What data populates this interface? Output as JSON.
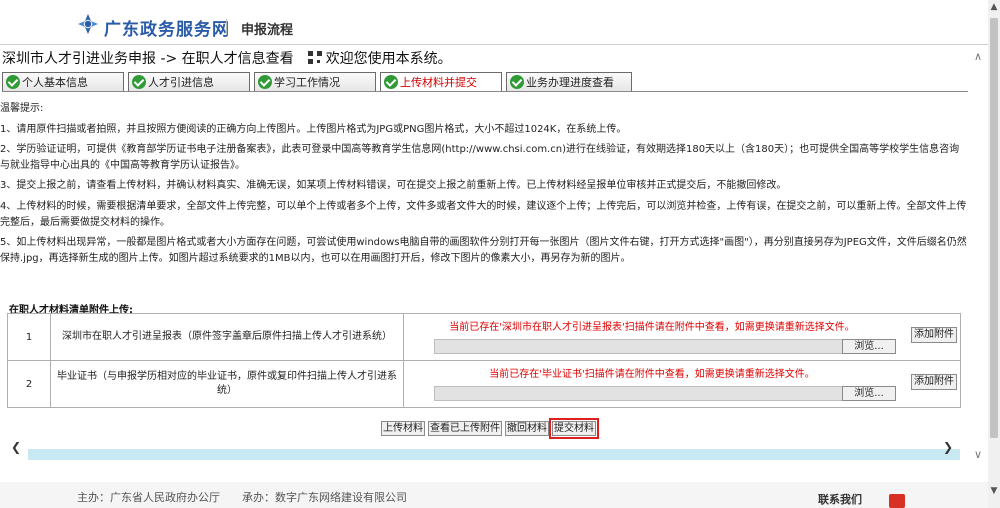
{
  "site": {
    "name": "广东政务服务网",
    "subtitle": "申报流程"
  },
  "page": {
    "breadcrumb": "深圳市人才引进业务申报 -> 在职人才信息查看",
    "welcome": "欢迎您使用本系统。"
  },
  "tabs": [
    {
      "label": "个人基本信息",
      "active": false
    },
    {
      "label": "人才引进信息",
      "active": false
    },
    {
      "label": "学习工作情况",
      "active": false
    },
    {
      "label": "上传材料并提交",
      "active": true
    },
    {
      "label": "业务办理进度查看",
      "active": false
    }
  ],
  "notes": {
    "heading": "温馨提示:",
    "items": [
      "1、请用原件扫描或者拍照，并且按照方便阅读的正确方向上传图片。上传图片格式为JPG或PNG图片格式，大小不超过1024K，在系统上传。",
      "2、学历验证证明，可提供《教育部学历证书电子注册备案表》，此表可登录中国高等教育学生信息网(http://www.chsi.com.cn)进行在线验证，有效期选择180天以上（含180天）；也可提供全国高等学校学生信息咨询与就业指导中心出具的《中国高等教育学历认证报告》。",
      "3、提交上报之前，请查看上传材料，并确认材料真实、准确无误，如某项上传材料错误，可在提交上报之前重新上传。已上传材料经呈报单位审核并正式提交后，不能撤回修改。",
      "4、上传材料的时候，需要根据清单要求，全部文件上传完整，可以单个上传或者多个上传，文件多或者文件大的时候，建议逐个上传；上传完后，可以浏览并检查，上传有误，在提交之前，可以重新上传。全部文件上传完整后，最后需要做提交材料的操作。",
      "5、如上传材料出现异常，一般都是图片格式或者大小方面存在问题，可尝试使用windows电脑自带的画图软件分别打开每一张图片（图片文件右键，打开方式选择\"画图\"），再分别直接另存为JPEG文件，文件后缀名仍然保持.jpg，再选择新生成的图片上传。如图片超过系统要求的1MB以内，也可以在用画图打开后，修改下图片的像素大小，再另存为新的图片。"
    ]
  },
  "attachments": {
    "title": "在职人才材料清单附件上传:",
    "browse_label": "浏览...",
    "add_label": "添加附件",
    "rows": [
      {
        "index": "1",
        "name": "深圳市在职人才引进呈报表（原件签字盖章后原件扫描上传人才引进系统）",
        "status": "当前已存在'深圳市在职人才引进呈报表'扫描件请在附件中查看，如需更换请重新选择文件。"
      },
      {
        "index": "2",
        "name": "毕业证书（与申报学历相对应的毕业证书，原件或复印件扫描上传人才引进系统）",
        "status": "当前已存在'毕业证书'扫描件请在附件中查看，如需更换请重新选择文件。"
      }
    ]
  },
  "actions": {
    "upload": "上传材料",
    "view_uploaded": "查看已上传附件",
    "withdraw": "撤回材料",
    "submit": "提交材料"
  },
  "footer": {
    "host": "主办：广东省人民政府办公厅",
    "organizer": "承办：数字广东网络建设有限公司",
    "contact": "联系我们"
  },
  "colors": {
    "brand": "#2a5ca8",
    "alert_red": "#e00000",
    "check_green": "#2f9a36",
    "scroll_cyan": "#c9e9f2"
  }
}
